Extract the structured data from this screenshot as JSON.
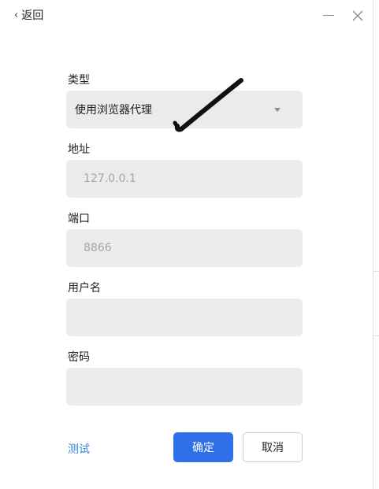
{
  "header": {
    "back_label": "返回"
  },
  "form": {
    "type_label": "类型",
    "type_value": "使用浏览器代理",
    "address_label": "地址",
    "address_placeholder": "127.0.0.1",
    "port_label": "端口",
    "port_placeholder": "8866",
    "username_label": "用户名",
    "username_value": "",
    "password_label": "密码",
    "password_value": ""
  },
  "actions": {
    "test_label": "测试",
    "ok_label": "确定",
    "cancel_label": "取消"
  },
  "icons": {
    "back": "chevron-left-icon",
    "minimize": "minimize-icon",
    "close": "close-icon",
    "dropdown": "caret-down-icon"
  },
  "colors": {
    "primary": "#2f6fe8",
    "link": "#3a86e0",
    "field_bg": "#ebebeb"
  }
}
